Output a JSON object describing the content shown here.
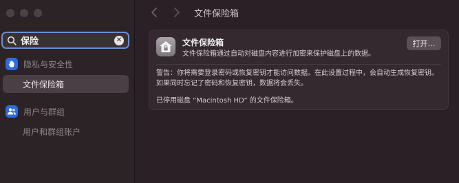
{
  "sidebar": {
    "search": {
      "value": "保险"
    },
    "groups": [
      {
        "label": "隐私与安全性",
        "icon": "hand-icon",
        "items": [
          {
            "label": "文件保险箱",
            "selected": true
          }
        ]
      },
      {
        "label": "用户与群组",
        "icon": "users-icon",
        "items": [
          {
            "label": "用户和群组账户",
            "selected": false
          }
        ]
      }
    ]
  },
  "header": {
    "title": "文件保险箱",
    "back_icon": "chevron-left-icon",
    "forward_icon": "chevron-right-icon"
  },
  "card": {
    "title": "文件保险箱",
    "description": "文件保险箱通过自动对磁盘内容进行加密来保护磁盘上的数据。",
    "open_button": "打开…",
    "warning": "警告：你将需要登录密码或恢复密钥才能访问数据。在此设置过程中，会自动生成恢复密钥。如果同时忘记了密码和恢复密钥，数据将会丢失。",
    "status": "已停用磁盘 “Macintosh HD” 的文件保险箱。"
  },
  "colors": {
    "accent": "#2d6ae0",
    "focus_ring": "#6a8fd0",
    "selection": "#4a3f44"
  }
}
